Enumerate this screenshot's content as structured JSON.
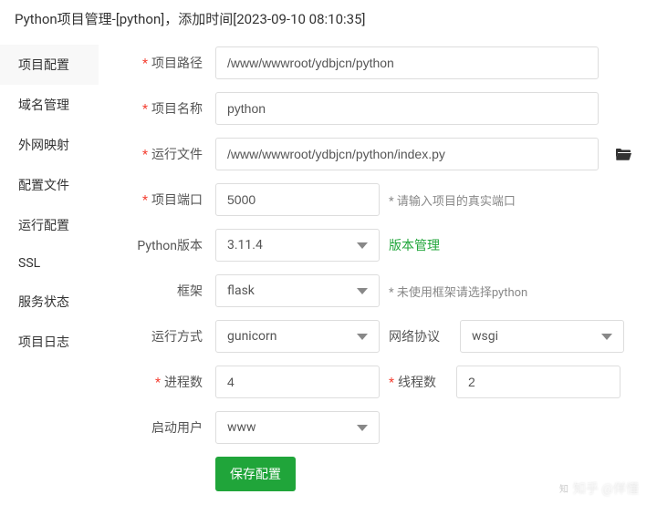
{
  "title": "Python项目管理-[python]，添加时间[2023-09-10 08:10:35]",
  "sidebar": {
    "items": [
      {
        "label": "项目配置"
      },
      {
        "label": "域名管理"
      },
      {
        "label": "外网映射"
      },
      {
        "label": "配置文件"
      },
      {
        "label": "运行配置"
      },
      {
        "label": "SSL"
      },
      {
        "label": "服务状态"
      },
      {
        "label": "项目日志"
      }
    ]
  },
  "form": {
    "project_path": {
      "label": "项目路径",
      "value": "/www/wwwroot/ydbjcn/python"
    },
    "project_name": {
      "label": "项目名称",
      "value": "python"
    },
    "run_file": {
      "label": "运行文件",
      "value": "/www/wwwroot/ydbjcn/python/index.py"
    },
    "project_port": {
      "label": "项目端口",
      "value": "5000",
      "hint": "请输入项目的真实端口"
    },
    "python_version": {
      "label": "Python版本",
      "value": "3.11.4",
      "manage_link": "版本管理"
    },
    "framework": {
      "label": "框架",
      "value": "flask",
      "hint": "未使用框架请选择python"
    },
    "run_mode": {
      "label": "运行方式",
      "value": "gunicorn"
    },
    "net_protocol": {
      "label": "网络协议",
      "value": "wsgi"
    },
    "process_num": {
      "label": "进程数",
      "value": "4"
    },
    "thread_num": {
      "label": "线程数",
      "value": "2"
    },
    "start_user": {
      "label": "启动用户",
      "value": "www"
    },
    "save_button": "保存配置"
  },
  "watermark": "知乎 @佯懂"
}
